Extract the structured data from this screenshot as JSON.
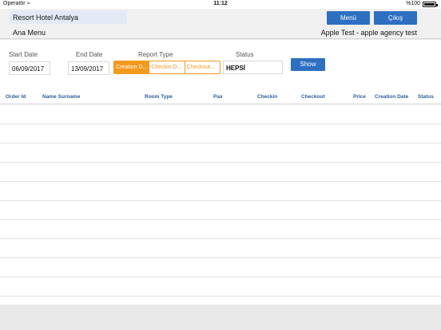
{
  "status_bar": {
    "carrier": "Operatör",
    "wifi_icon": "wifi-icon",
    "time": "11:12",
    "battery": "%100",
    "battery_icon": "battery-icon"
  },
  "header": {
    "hotel_name": "Resort Hotel Antalya",
    "menu_label": "Ana Menu",
    "menu_button": "Menü",
    "exit_button": "Çıkış",
    "agency_text": "Apple Test - apple agency test",
    "accent_color": "#2e6fc1"
  },
  "filters": {
    "start_date_label": "Start Date",
    "start_date": "06/09/2017",
    "end_date_label": "End Date",
    "end_date": "13/09/2017",
    "report_type_label": "Report Type",
    "report_types": [
      "Creation D...",
      "Checkin D...",
      "Checkout..."
    ],
    "selected_report_type": "Creation D...",
    "status_label": "Status",
    "status_value": "HEPSİ",
    "show_button": "Show",
    "segment_color": "#f39a1e"
  },
  "table": {
    "columns": [
      "Order Id",
      "Name Surname",
      "Room Type",
      "Pax",
      "Checkin",
      "Checkout",
      "Price",
      "Creation Date",
      "Status"
    ],
    "rows": []
  }
}
